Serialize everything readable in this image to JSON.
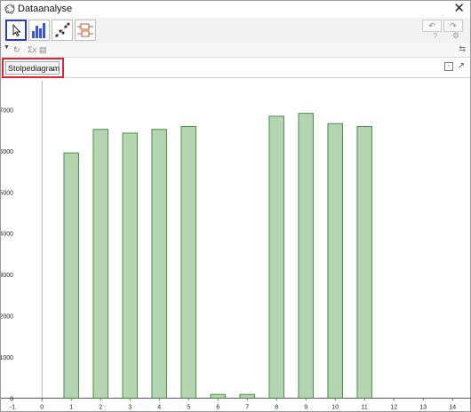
{
  "window": {
    "title": "Dataanalyse",
    "close_glyph": "✕"
  },
  "toolbar": {
    "tools": [
      {
        "name": "move-tool-icon",
        "selected": true
      },
      {
        "name": "histogram-tool-icon",
        "selected": false
      },
      {
        "name": "scatter-tool-icon",
        "selected": false
      },
      {
        "name": "boxplot-tool-icon",
        "selected": false
      }
    ],
    "undo_glyph": "↶",
    "redo_glyph": "↷",
    "help_glyph": "?",
    "settings_glyph": "⚙"
  },
  "subbar": {
    "sigma_label": "Σx",
    "toggle_glyph": "⇆"
  },
  "plot": {
    "view_selected": "Stolpediagram",
    "dropdown_arrow": "⌄",
    "export_glyph": "⧉",
    "detach_glyph": "↗"
  },
  "colors": {
    "bar_fill": "#b5d4b2",
    "bar_stroke": "#4b8f45",
    "highlight": "#e3232d",
    "selected_tool_border": "#2a3fb0"
  },
  "chart_data": {
    "type": "bar",
    "categories": [
      1,
      2,
      3,
      4,
      5,
      6,
      7,
      8,
      9,
      10,
      11
    ],
    "values": [
      5950,
      6520,
      6430,
      6520,
      6590,
      90,
      90,
      6840,
      6910,
      6660,
      6590
    ],
    "xticks": [
      -1,
      0,
      1,
      2,
      3,
      4,
      5,
      6,
      7,
      8,
      9,
      10,
      11,
      12,
      13,
      14
    ],
    "yticks": [
      0,
      1000,
      2000,
      3000,
      4000,
      5000,
      6000,
      7000
    ],
    "xlim": [
      -1.4,
      14.6
    ],
    "ylim": [
      -100,
      7700
    ],
    "grid": false,
    "title": "",
    "xlabel": "",
    "ylabel": ""
  }
}
